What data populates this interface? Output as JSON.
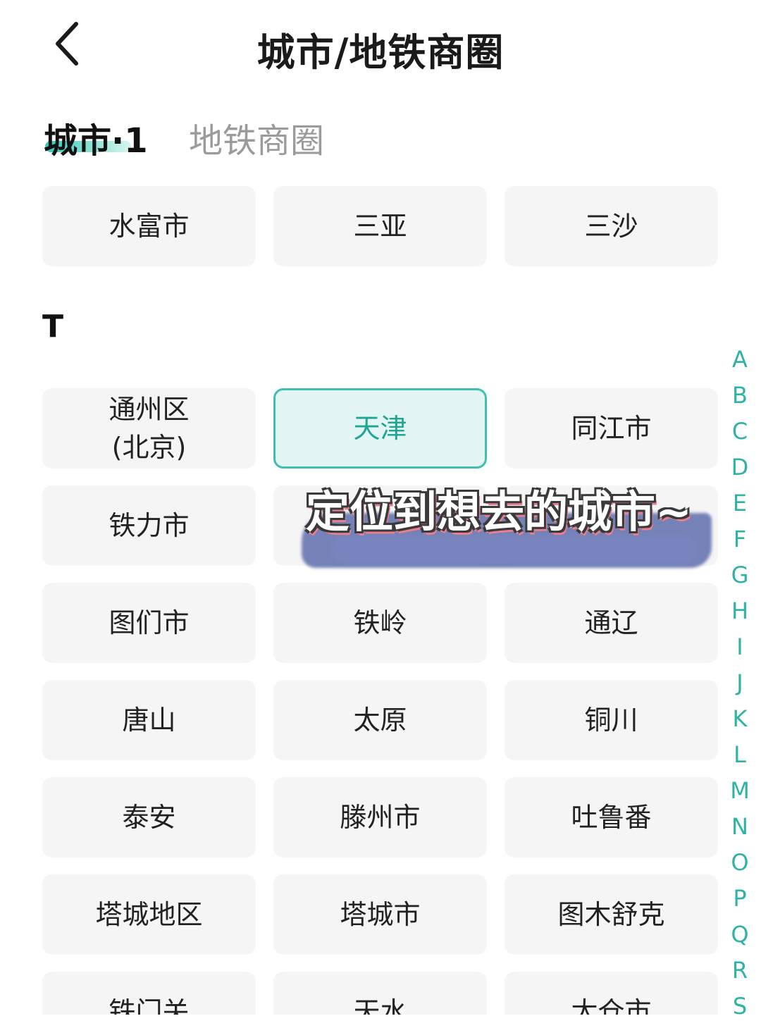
{
  "header": {
    "title": "城市/地铁商圈",
    "back_icon": "chevron-left-icon"
  },
  "tabs": [
    {
      "label": "城市·1",
      "active": true
    },
    {
      "label": "地铁商圈",
      "active": false
    }
  ],
  "colors": {
    "accent": "#3fbfb1",
    "selected_bg": "#e4f6f3",
    "card_bg": "#f5f5f5",
    "inactive_tab": "#9b9b9b"
  },
  "top_row": [
    "水富市",
    "三亚",
    "三沙"
  ],
  "section": {
    "letter": "T",
    "cities": [
      [
        "通州区\n(北京)",
        "天津",
        "同江市"
      ],
      [
        "铁力市",
        "",
        ""
      ],
      [
        "图们市",
        "铁岭",
        "通辽"
      ],
      [
        "唐山",
        "太原",
        "铜川"
      ],
      [
        "泰安",
        "滕州市",
        "吐鲁番"
      ],
      [
        "塔城地区",
        "塔城市",
        "图木舒克"
      ],
      [
        "铁门关",
        "天水",
        "太仓市"
      ]
    ],
    "selected": "天津"
  },
  "overlay_caption": "定位到想去的城市~",
  "index_letters": [
    "A",
    "B",
    "C",
    "D",
    "E",
    "F",
    "G",
    "H",
    "I",
    "J",
    "K",
    "L",
    "M",
    "N",
    "O",
    "P",
    "Q",
    "R",
    "S"
  ]
}
